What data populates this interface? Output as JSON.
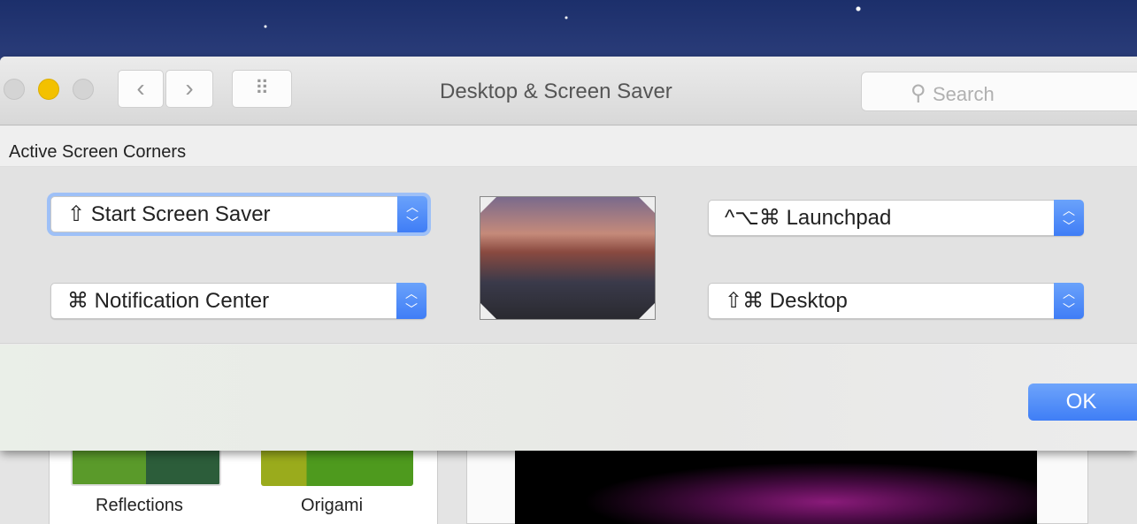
{
  "window": {
    "title": "Desktop & Screen Saver",
    "search_placeholder": "Search"
  },
  "toolbar": {
    "back_label": "‹",
    "forward_label": "›",
    "grid_label": "⠿"
  },
  "sheet": {
    "heading": "Active Screen Corners",
    "corners": {
      "top_left": "⇧ Start Screen Saver",
      "bottom_left": "⌘ Notification Center",
      "top_right": "^⌥⌘ Launchpad",
      "bottom_right": "⇧⌘ Desktop"
    },
    "ok_label": "OK"
  },
  "background": {
    "screen_savers": [
      "Reflections",
      "Origami"
    ]
  },
  "colors": {
    "accent": "#3f7ef6",
    "minimize": "#f3c100"
  }
}
